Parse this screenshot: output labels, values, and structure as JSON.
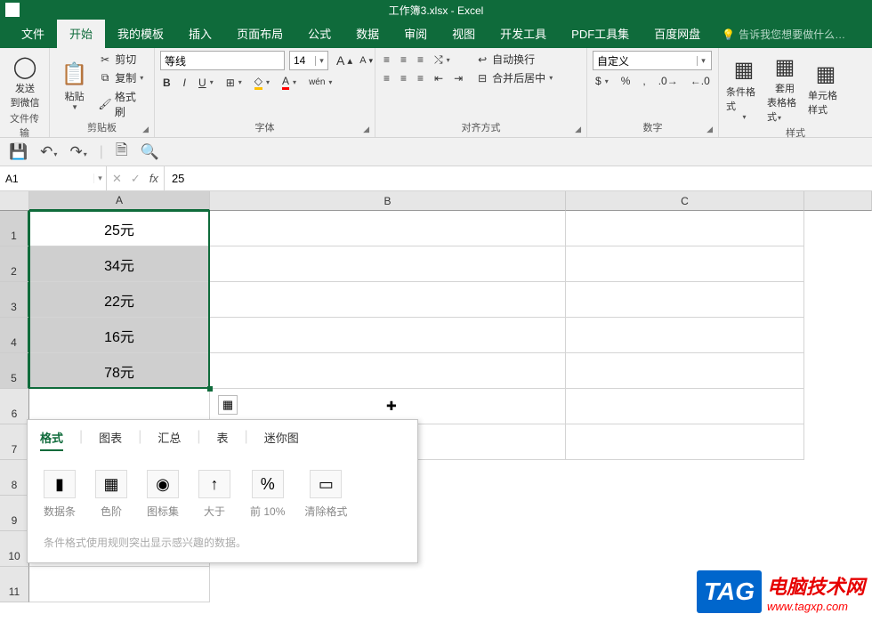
{
  "titlebar": {
    "title": "工作簿3.xlsx - Excel"
  },
  "tabs": {
    "file": "文件",
    "home": "开始",
    "mytpl": "我的模板",
    "insert": "插入",
    "layout": "页面布局",
    "formulas": "公式",
    "data": "数据",
    "review": "审阅",
    "view": "视图",
    "dev": "开发工具",
    "pdf": "PDF工具集",
    "baidu": "百度网盘",
    "tellme": "告诉我您想要做什么…"
  },
  "ribbon": {
    "wechat": {
      "send": "发送",
      "to": "到微信",
      "group": "文件传输"
    },
    "clipboard": {
      "paste": "粘贴",
      "cut": "剪切",
      "copy": "复制",
      "painter": "格式刷",
      "group": "剪贴板"
    },
    "font": {
      "name": "等线",
      "size": "14",
      "group": "字体",
      "aplus": "A",
      "aminus": "A"
    },
    "align": {
      "wrap": "自动换行",
      "merge": "合并后居中",
      "group": "对齐方式"
    },
    "number": {
      "fmt": "自定义",
      "group": "数字"
    },
    "styles": {
      "cond": "条件格式",
      "table": "套用",
      "table2": "表格格式",
      "cell": "单元格样式",
      "group": "样式"
    }
  },
  "formula_bar": {
    "ref": "A1",
    "value": "25"
  },
  "columns": [
    "A",
    "B",
    "C"
  ],
  "cells": {
    "a1": "25元",
    "a2": "34元",
    "a3": "22元",
    "a4": "16元",
    "a5": "78元"
  },
  "quick_analysis": {
    "tabs": {
      "fmt": "格式",
      "chart": "图表",
      "total": "汇总",
      "table": "表",
      "spark": "迷你图"
    },
    "opts": {
      "databar": "数据条",
      "colorscale": "色阶",
      "iconset": "图标集",
      "gt": "大于",
      "top10": "前 10%",
      "clear": "清除格式"
    },
    "hint": "条件格式使用规则突出显示感兴趣的数据。"
  },
  "watermark": {
    "tag": "TAG",
    "name": "电脑技术网",
    "url": "www.tagxp.com"
  }
}
